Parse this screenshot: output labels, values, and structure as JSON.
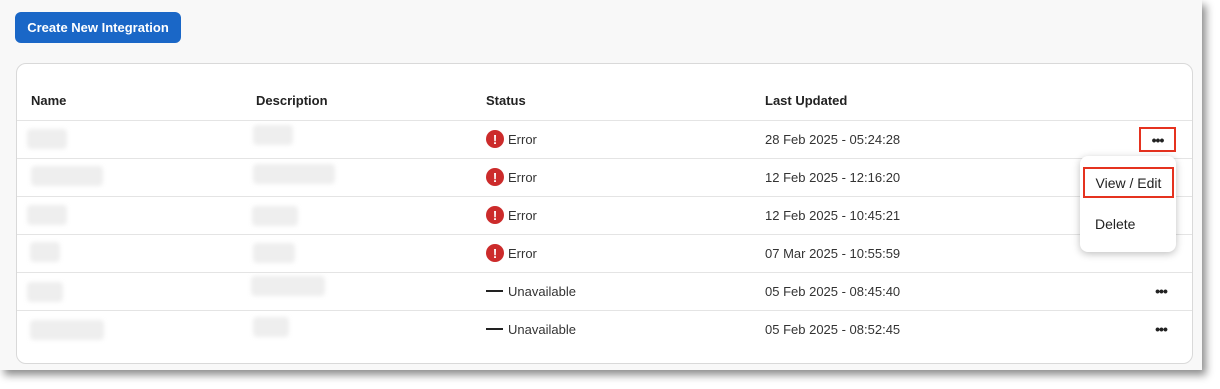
{
  "toolbar": {
    "create_label": "Create New Integration"
  },
  "table": {
    "headers": {
      "name": "Name",
      "description": "Description",
      "status": "Status",
      "last_updated": "Last Updated"
    },
    "rows": [
      {
        "status": "Error",
        "status_type": "error",
        "updated": "28 Feb 2025 - 05:24:28"
      },
      {
        "status": "Error",
        "status_type": "error",
        "updated": "12 Feb 2025 - 12:16:20"
      },
      {
        "status": "Error",
        "status_type": "error",
        "updated": "12 Feb 2025 - 10:45:21"
      },
      {
        "status": "Error",
        "status_type": "error",
        "updated": "07 Mar 2025 - 10:55:59"
      },
      {
        "status": "Unavailable",
        "status_type": "unavailable",
        "updated": "05 Feb 2025 - 08:45:40"
      },
      {
        "status": "Unavailable",
        "status_type": "unavailable",
        "updated": "05 Feb 2025 - 08:52:45"
      }
    ]
  },
  "icons": {
    "error": "exclamation-circle-icon",
    "unavailable": "dash-icon",
    "more": "ellipsis-icon"
  },
  "context_menu": {
    "view_edit": "View / Edit",
    "delete": "Delete"
  },
  "colors": {
    "primary": "#1a67c7",
    "error": "#cc2b2b",
    "highlight": "#e5321f"
  }
}
